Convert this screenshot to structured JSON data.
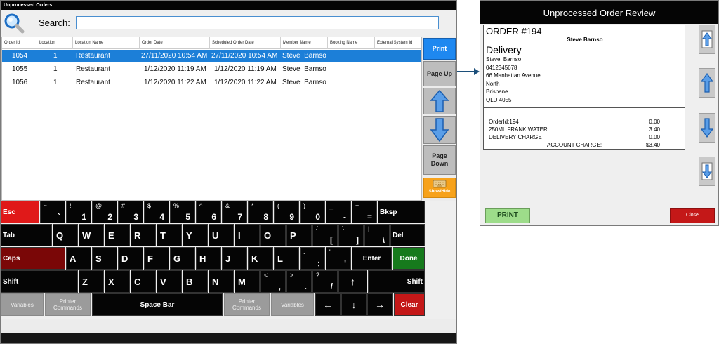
{
  "left_window": {
    "title": "Unprocessed Orders",
    "search_label": "Search:",
    "search_value": "",
    "columns": [
      "Order Id",
      "Location",
      "Location Name",
      "Order Date",
      "Scheduled Order Date",
      "Member Name",
      "Booking Name",
      "External System Id"
    ],
    "rows": [
      {
        "order_id": "1054",
        "location": "1",
        "location_name": "Restaurant",
        "order_date": "27/11/2020 10:54 AM",
        "scheduled": "27/11/2020 10:54 AM",
        "member": "Steve  Barnso",
        "booking": "",
        "external": "",
        "selected": true
      },
      {
        "order_id": "1055",
        "location": "1",
        "location_name": "Restaurant",
        "order_date": "1/12/2020 11:19 AM",
        "scheduled": "1/12/2020 11:19 AM",
        "member": "Steve  Barnso",
        "booking": "",
        "external": "",
        "selected": false
      },
      {
        "order_id": "1056",
        "location": "1",
        "location_name": "Restaurant",
        "order_date": "1/12/2020 11:22 AM",
        "scheduled": "1/12/2020 11:22 AM",
        "member": "Steve  Barnso",
        "booking": "",
        "external": "",
        "selected": false
      }
    ],
    "side_buttons": {
      "print": "Print",
      "page_up": "Page Up",
      "page_down": "Page Down",
      "show_hide": "Show/Hide"
    }
  },
  "keyboard": {
    "row1": [
      {
        "shift": "~",
        "base": "`"
      },
      {
        "shift": "!",
        "base": "1"
      },
      {
        "shift": "@",
        "base": "2"
      },
      {
        "shift": "#",
        "base": "3"
      },
      {
        "shift": "$",
        "base": "4"
      },
      {
        "shift": "%",
        "base": "5"
      },
      {
        "shift": "^",
        "base": "6"
      },
      {
        "shift": "&",
        "base": "7"
      },
      {
        "shift": "*",
        "base": "8"
      },
      {
        "shift": "(",
        "base": "9"
      },
      {
        "shift": ")",
        "base": "0"
      },
      {
        "shift": "_",
        "base": "-"
      },
      {
        "shift": "+",
        "base": "="
      }
    ],
    "row2": [
      "Q",
      "W",
      "E",
      "R",
      "T",
      "Y",
      "U",
      "I",
      "O",
      "P"
    ],
    "row2_sym": [
      {
        "shift": "{",
        "base": "["
      },
      {
        "shift": "}",
        "base": "]"
      },
      {
        "shift": "|",
        "base": "\\"
      }
    ],
    "row3": [
      "A",
      "S",
      "D",
      "F",
      "G",
      "H",
      "J",
      "K",
      "L"
    ],
    "row3_sym": [
      {
        "shift": ":",
        "base": ";"
      },
      {
        "shift": "\"",
        "base": "'"
      }
    ],
    "row4": [
      "Z",
      "X",
      "C",
      "V",
      "B",
      "N",
      "M"
    ],
    "row4_sym": [
      {
        "shift": "<",
        "base": ","
      },
      {
        "shift": ">",
        "base": "."
      },
      {
        "shift": "?",
        "base": "/"
      }
    ],
    "esc": "Esc",
    "bksp": "Bksp",
    "tab": "Tab",
    "del": "Del",
    "caps": "Caps",
    "enter": "Enter",
    "done": "Done",
    "shift_l": "Shift",
    "shift_r": "Shift",
    "variables_l": "Variables",
    "printer_commands_l": "Printer Commands",
    "space": "Space Bar",
    "printer_commands_r": "Printer Commands",
    "variables_r": "Variables",
    "arrow_up": "↑",
    "arrow_left": "←",
    "arrow_down": "↓",
    "arrow_right": "→",
    "clear": "Clear"
  },
  "right_window": {
    "title": "Unprocessed Order Review",
    "order_header": "ORDER #194",
    "member_name": "Steve Barnso",
    "delivery_label": "Delivery",
    "address_lines": [
      "Steve  Barnso",
      "0412345678",
      "66 Manhattan Avenue",
      "North",
      "Brisbane",
      "QLD 4055"
    ],
    "items": [
      {
        "name": "OrderId:194",
        "value": "0.00"
      },
      {
        "name": "250ML FRANK WATER",
        "value": "3.40"
      },
      {
        "name": "DELIVERY CHARGE",
        "value": "0.00"
      }
    ],
    "total_label": "ACCOUNT CHARGE:",
    "total_value": "$3.40",
    "print_label": "PRINT",
    "close_label": "Close"
  },
  "colors": {
    "selection": "#1c7fd8",
    "print_button": "#1e88f0",
    "show_hide": "#f7a21b",
    "esc_key": "#e01919",
    "caps_key": "#7a0707",
    "done_key": "#167a1c",
    "clear_key": "#c41818",
    "print_review": "#9ddc8a"
  }
}
